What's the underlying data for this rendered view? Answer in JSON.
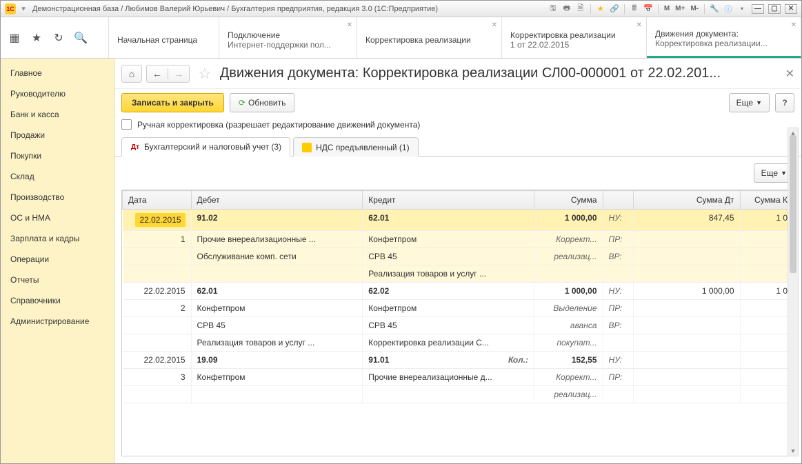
{
  "titlebar": {
    "app_logo": "1C",
    "title": "Демонстрационная база / Любимов Валерий Юрьевич / Бухгалтерия предприятия, редакция 3.0  (1С:Предприятие)",
    "mbuttons": [
      "M",
      "M+",
      "M-"
    ]
  },
  "topnav": {
    "tabs": [
      {
        "line1": "Начальная страница",
        "line2": ""
      },
      {
        "line1": "Подключение",
        "line2": "Интернет-поддержки пол..."
      },
      {
        "line1": "Корректировка реализации",
        "line2": ""
      },
      {
        "line1": "Корректировка реализации",
        "line2": "1 от 22.02.2015"
      },
      {
        "line1": "Движения документа:",
        "line2": "Корректировка реализации..."
      }
    ]
  },
  "sidebar": {
    "items": [
      "Главное",
      "Руководителю",
      "Банк и касса",
      "Продажи",
      "Покупки",
      "Склад",
      "Производство",
      "ОС и НМА",
      "Зарплата и кадры",
      "Операции",
      "Отчеты",
      "Справочники",
      "Администрирование"
    ]
  },
  "page": {
    "title": "Движения документа: Корректировка реализации СЛ00-000001 от 22.02.201..."
  },
  "toolbar": {
    "save_close": "Записать и закрыть",
    "refresh": "Обновить",
    "more": "Еще",
    "help": "?"
  },
  "check": {
    "label": "Ручная корректировка (разрешает редактирование движений документа)"
  },
  "doctabs": {
    "tab1": "Бухгалтерский и налоговый учет (3)",
    "tab2": "НДС предъявленный (1)"
  },
  "grid": {
    "more": "Еще",
    "headers": {
      "date": "Дата",
      "debit": "Дебет",
      "credit": "Кредит",
      "sum": "Сумма",
      "sumdt": "Сумма Дт",
      "sumkt": "Сумма К"
    },
    "rows": [
      {
        "hl": true,
        "date": "22.02.2015",
        "num": "1",
        "debit_acct": "91.02",
        "debit_lines": [
          "Прочие внереализационные ...",
          "Обслуживание комп. сети"
        ],
        "credit_acct": "62.01",
        "credit_lines": [
          "Конфетпром",
          "СРВ 45",
          "Реализация товаров и услуг ..."
        ],
        "sum": "1 000,00",
        "sum_note": [
          "Коррект...",
          "реализац..."
        ],
        "lbls": [
          "НУ:",
          "ПР:",
          "ВР:"
        ],
        "sumdt": "847,45",
        "sumkt": "1 0"
      },
      {
        "hl": false,
        "date": "22.02.2015",
        "num": "2",
        "debit_acct": "62.01",
        "debit_lines": [
          "Конфетпром",
          "СРВ 45",
          "Реализация товаров и услуг ..."
        ],
        "credit_acct": "62.02",
        "credit_lines": [
          "Конфетпром",
          "СРВ 45",
          "Корректировка реализации С..."
        ],
        "sum": "1 000,00",
        "sum_note": [
          "Выделение",
          "аванса",
          "покупат..."
        ],
        "lbls": [
          "НУ:",
          "ПР:",
          "ВР:"
        ],
        "sumdt": "1 000,00",
        "sumkt": "1 0"
      },
      {
        "hl": false,
        "date": "22.02.2015",
        "num": "3",
        "debit_acct": "19.09",
        "debit_lines": [
          "Конфетпром"
        ],
        "credit_acct": "91.01",
        "credit_extra": "Кол.:",
        "credit_lines": [
          "Прочие внереализационные д..."
        ],
        "sum": "152,55",
        "sum_note": [
          "Коррект...",
          "реализац..."
        ],
        "lbls": [
          "НУ:",
          "ПР:"
        ],
        "sumdt": "",
        "sumkt": ""
      }
    ]
  }
}
